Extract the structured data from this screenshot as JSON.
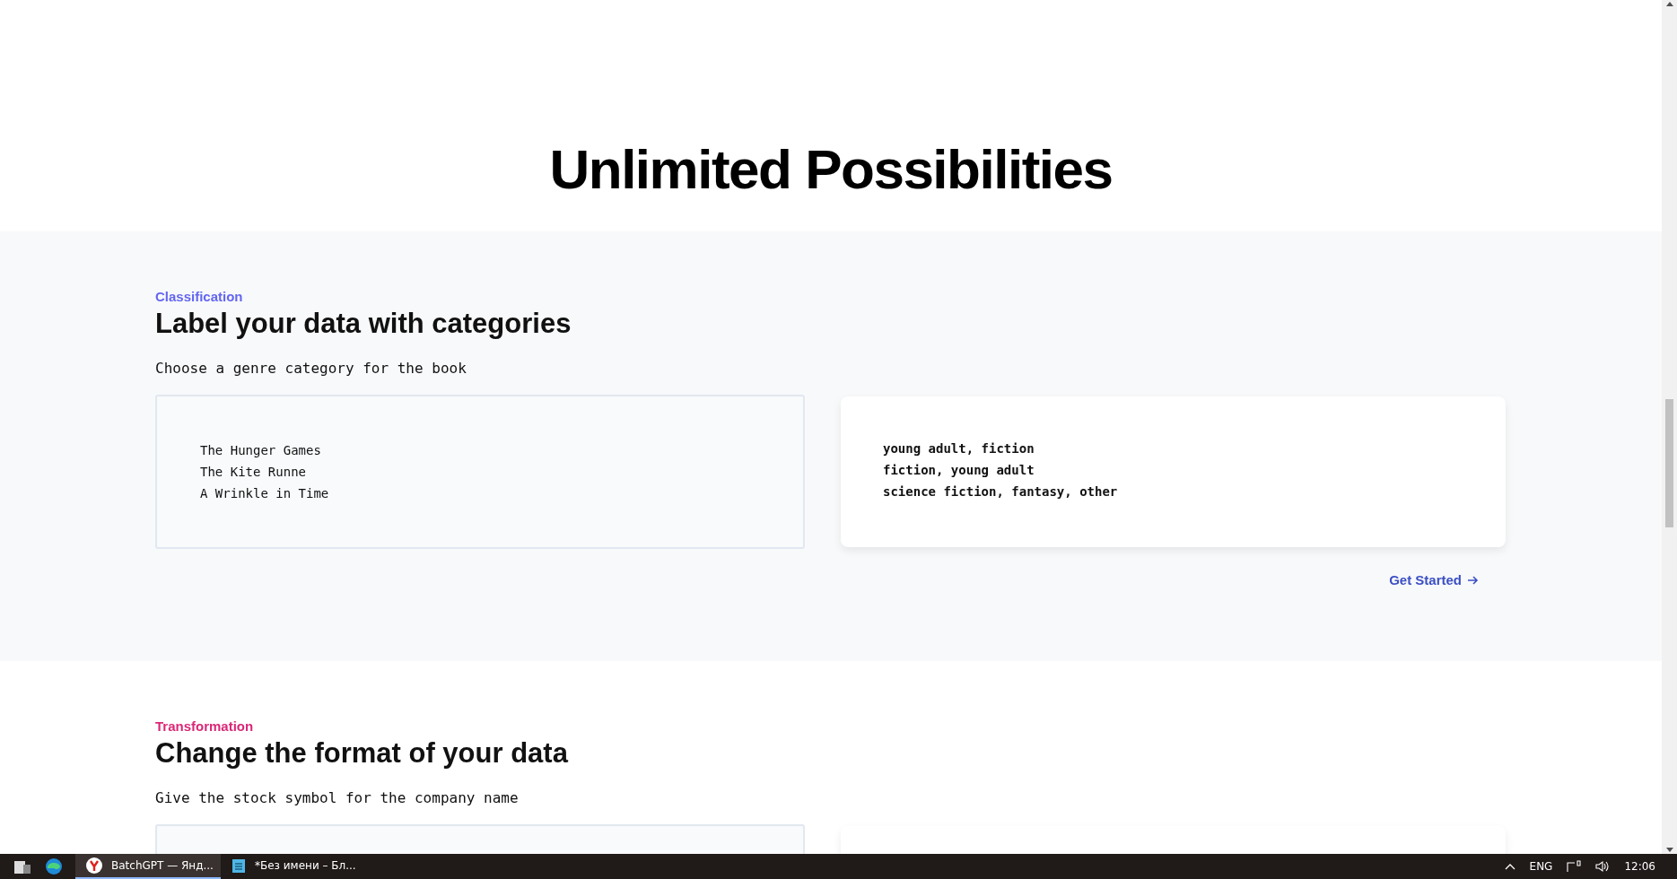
{
  "hero": {
    "title": "Unlimited Possibilities"
  },
  "sections": [
    {
      "label": "Classification",
      "color": "#6366f1",
      "title": "Label your data with categories",
      "prompt": "Choose a genre category for the book",
      "inputs": [
        "The Hunger Games",
        "The Kite Runne",
        "A Wrinkle in Time"
      ],
      "outputs": [
        "young adult, fiction",
        "fiction, young adult",
        "science fiction, fantasy, other"
      ],
      "link": "Get Started"
    },
    {
      "label": "Transformation",
      "color": "#db2777",
      "title": "Change the format of your data",
      "prompt": "Give the stock symbol for the company name"
    }
  ],
  "taskbar": {
    "apps": [
      {
        "label": "BatchGPT — Янд...",
        "selected": true,
        "kind": "browser"
      },
      {
        "label": "*Без имени – Бл...",
        "selected": false,
        "kind": "notepad"
      }
    ],
    "language": "ENG",
    "time": "12:06"
  }
}
